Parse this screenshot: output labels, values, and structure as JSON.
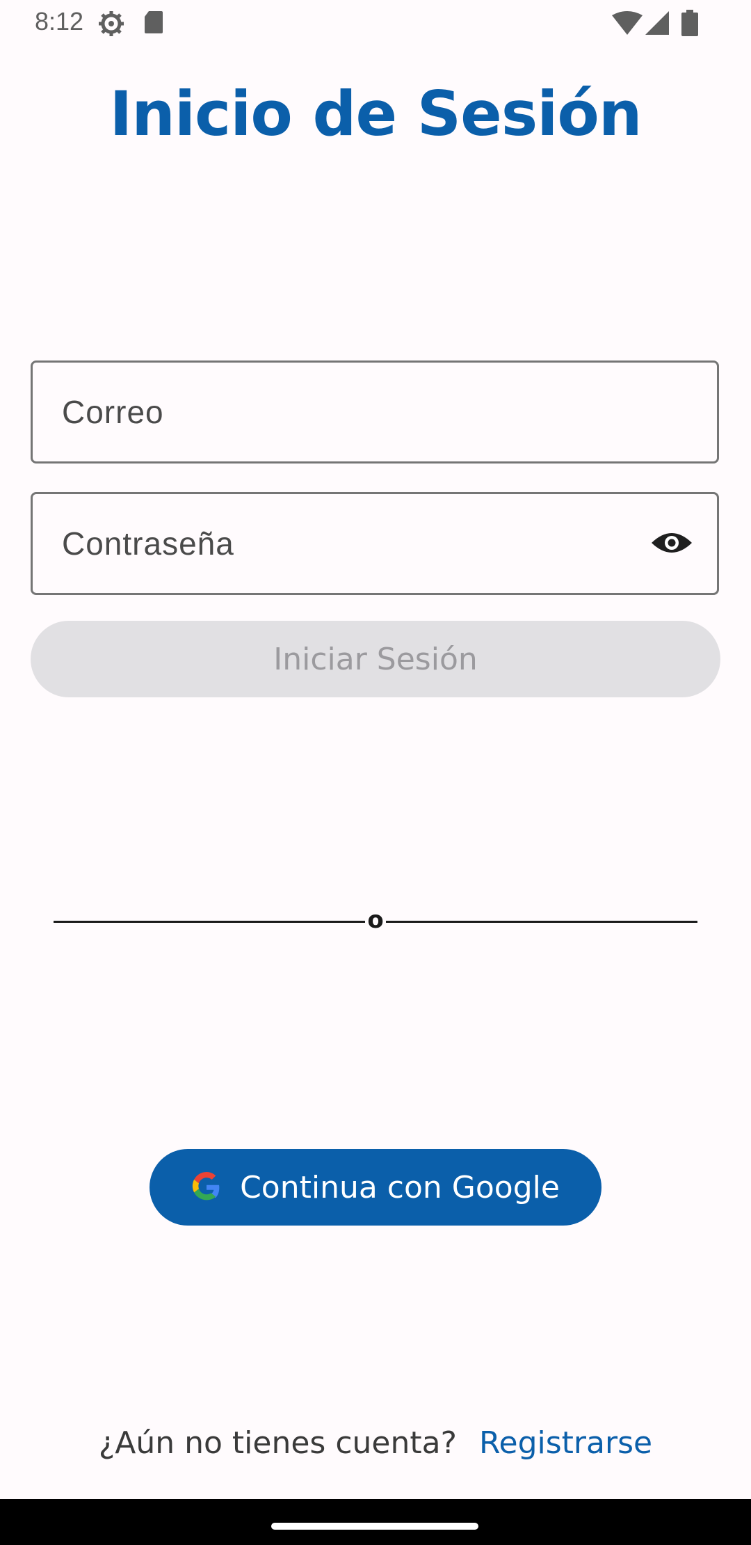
{
  "status_bar": {
    "time": "8:12",
    "icons": [
      "settings-gear-icon",
      "sd-card-icon",
      "wifi-icon",
      "cell-signal-icon",
      "battery-icon"
    ]
  },
  "title": "Inicio de Sesión",
  "form": {
    "email_label": "Correo",
    "password_label": "Contraseña",
    "login_button": "Iniciar Sesión"
  },
  "divider_text": "o",
  "google_button": {
    "label": "Continua con Google",
    "icon": "google-icon"
  },
  "footer": {
    "question": "¿Aún no tienes cuenta?",
    "link": "Registrarse"
  },
  "colors": {
    "primary": "#0b5faa",
    "disabled_bg": "#e1e0e3",
    "disabled_text": "#9b9a9e",
    "background": "#fffbfd"
  }
}
